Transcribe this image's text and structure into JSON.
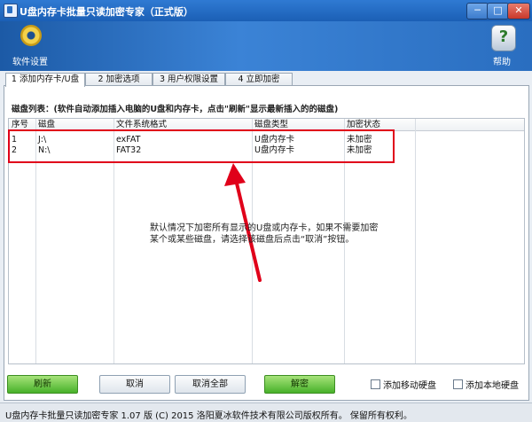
{
  "window": {
    "title": "U盘内存卡批量只读加密专家（正式版）",
    "controls": {
      "minimize": "─",
      "maximize": "□",
      "close": "✕"
    }
  },
  "header": {
    "settings_label": "软件设置",
    "help_label": "帮助",
    "help_glyph": "?"
  },
  "tabs": [
    {
      "label": "1 添加内存卡/U盘",
      "active": true
    },
    {
      "label": "2 加密选项",
      "active": false
    },
    {
      "label": "3 用户权限设置",
      "active": false
    },
    {
      "label": "4 立即加密",
      "active": false
    }
  ],
  "disk_list": {
    "caption": "磁盘列表：(软件自动添加插入电脑的U盘和内存卡，点击\"刷新\"显示最新插入的的磁盘)",
    "columns": [
      "序号",
      "磁盘",
      "文件系统格式",
      "磁盘类型",
      "加密状态"
    ],
    "rows": [
      {
        "no": "1",
        "disk": "J:\\",
        "fs": "exFAT",
        "type": "U盘内存卡",
        "status": "未加密"
      },
      {
        "no": "2",
        "disk": "N:\\",
        "fs": "FAT32",
        "type": "U盘内存卡",
        "status": "未加密"
      }
    ]
  },
  "annotation": {
    "hint_line1": "默认情况下加密所有显示的U盘或内存卡，如果不需要加密",
    "hint_line2": "某个或某些磁盘，请选择该磁盘后点击“取消”按钮。",
    "accent_color": "#e0001a"
  },
  "buttons": {
    "refresh": "刷新",
    "cancel": "取消",
    "cancel_all": "取消全部",
    "decrypt": "解密"
  },
  "checkboxes": {
    "add_removable": "添加移动硬盘",
    "add_local": "添加本地硬盘"
  },
  "status_bar": {
    "text": "U盘内存卡批量只读加密专家 1.07 版  (C)  2015 洛阳夏冰软件技术有限公司版权所有。 保留所有权利。"
  }
}
